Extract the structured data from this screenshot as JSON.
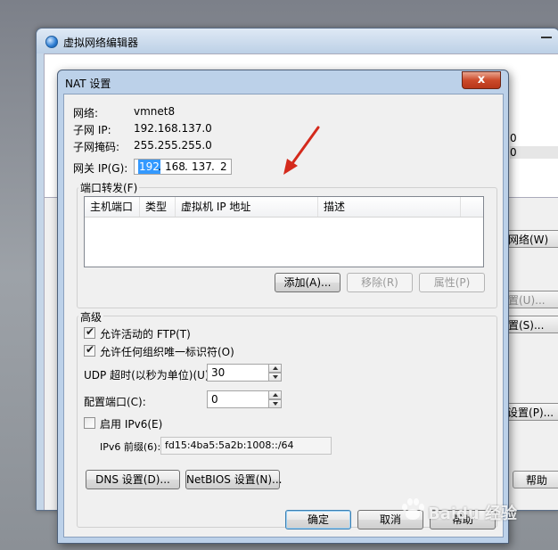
{
  "parent_window": {
    "title": "虚拟网络编辑器",
    "values": [
      "0",
      "0"
    ],
    "buttons": {
      "rename": "名网络(W)",
      "settings_u": "设置(U)...",
      "settings_s": "设置(S)...",
      "settings_p": "P 设置(P)...",
      "help": "帮助"
    }
  },
  "dialog": {
    "title": "NAT 设置",
    "close_glyph": "x",
    "network": {
      "label": "网络:",
      "value": "vmnet8"
    },
    "subnet_ip": {
      "label": "子网 IP:",
      "value": "192.168.137.0"
    },
    "subnet_mask": {
      "label": "子网掩码:",
      "value": "255.255.255.0"
    },
    "gateway": {
      "label": "网关 IP(G):",
      "segments": [
        "192",
        "168",
        "137",
        "2"
      ],
      "dot": "."
    },
    "port_forward": {
      "title": "端口转发(F)",
      "columns": [
        "主机端口",
        "类型",
        "虚拟机 IP 地址",
        "描述"
      ],
      "add": "添加(A)...",
      "remove": "移除(R)",
      "properties": "属性(P)"
    },
    "advanced": {
      "title": "高级",
      "allow_ftp": {
        "label": "允许活动的 FTP(T)",
        "checked": true
      },
      "allow_org": {
        "label": "允许任何组织唯一标识符(O)",
        "checked": true
      },
      "udp_timeout": {
        "label": "UDP 超时(以秒为单位)(U):",
        "value": "30"
      },
      "config_port": {
        "label": "配置端口(C):",
        "value": "0"
      },
      "enable_ipv6": {
        "label": "启用 IPv6(E)",
        "checked": false
      },
      "ipv6_prefix": {
        "label": "IPv6 前缀(6):",
        "value": "fd15:4ba5:5a2b:1008::/64"
      },
      "dns_button": "DNS 设置(D)...",
      "netbios_button": "NetBIOS 设置(N)..."
    },
    "ok": "确定",
    "cancel": "取消",
    "help": "帮助",
    "check_glyph": "✔"
  },
  "watermark": "Baidu 经验",
  "colors": {
    "arrow": "#d42a1c",
    "title_bar": "#bcd1e9",
    "selection": "#3399ff"
  }
}
